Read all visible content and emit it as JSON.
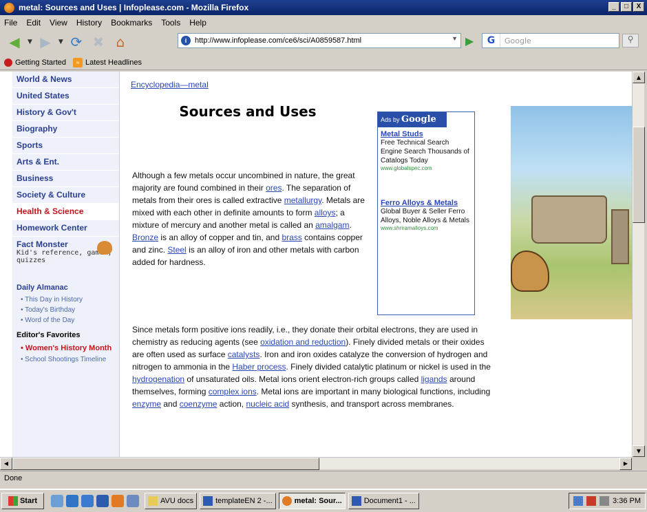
{
  "window": {
    "title": "metal: Sources and Uses | Infoplease.com - Mozilla Firefox",
    "controls": [
      "_",
      "□",
      "X"
    ]
  },
  "menu": [
    "File",
    "Edit",
    "View",
    "History",
    "Bookmarks",
    "Tools",
    "Help"
  ],
  "toolbar": {
    "url": "http://www.infoplease.com/ce6/sci/A0859587.html",
    "search_placeholder": "Google",
    "search_engine": "G"
  },
  "bookmarks": [
    "Getting Started",
    "Latest Headlines"
  ],
  "sidebar": {
    "items": [
      {
        "label": "World & News",
        "active": false
      },
      {
        "label": "United States",
        "active": false
      },
      {
        "label": "History & Gov't",
        "active": false
      },
      {
        "label": "Biography",
        "active": false
      },
      {
        "label": "Sports",
        "active": false
      },
      {
        "label": "Arts & Ent.",
        "active": false
      },
      {
        "label": "Business",
        "active": false
      },
      {
        "label": "Society & Culture",
        "active": false
      },
      {
        "label": "Health & Science",
        "active": true
      },
      {
        "label": "Homework Center",
        "active": false
      }
    ],
    "fact_monster": {
      "title": "Fact Monster",
      "desc": "Kid's reference, games, quizzes"
    },
    "almanac": {
      "title": "Daily Almanac",
      "links": [
        "This Day in History",
        "Today's Birthday",
        "Word of the Day"
      ]
    },
    "favorites": {
      "title": "Editor's Favorites",
      "links": [
        "Women's History Month",
        "School Shootings Timeline"
      ]
    }
  },
  "article": {
    "breadcrumb": [
      "Encyclopedia",
      "metal"
    ],
    "title": "Sources and Uses",
    "p1": "Although a few metals occur uncombined in nature, the great majority are found combined in their ores. The separation of metals from their ores is called extractive metallurgy. Metals are mixed with each other in definite amounts to form alloys; a mixture of mercury and another metal is called an amalgam. Bronze is an alloy of copper and tin, and brass contains copper and zinc. Steel is an alloy of iron and other metals with carbon added for hardness.",
    "p2": "Since metals form positive ions readily, i.e., they donate their orbital electrons, they are used in chemistry as reducing agents (see oxidation and reduction). Finely divided metals or their oxides are often used as surface catalysts. Iron and iron oxides catalyze the conversion of hydrogen and nitrogen to ammonia in the Haber process. Finely divided catalytic platinum or nickel is used in the hydrogenation of unsaturated oils. Metal ions orient electron-rich groups called ligands around themselves, forming complex ions. Metal ions are important in many biological functions, including enzyme and coenzyme action, nucleic acid synthesis, and transport across membranes."
  },
  "ads": {
    "header_small": "Ads by",
    "header_brand": "Google",
    "items": [
      {
        "title": "Metal Studs",
        "desc": "Free Technical Search Engine Search Thousands of Catalogs Today",
        "url": "www.globalspec.com"
      },
      {
        "title": "Ferro Alloys & Metals",
        "desc": "Global Buyer & Seller Ferro Alloys, Noble Alloys & Metals",
        "url": "www.shriramalloys.com"
      }
    ]
  },
  "status": "Done",
  "taskbar": {
    "start": "Start",
    "items": [
      {
        "label": "AVU docs",
        "active": false
      },
      {
        "label": "templateEN 2 -...",
        "active": false
      },
      {
        "label": "metal: Sour...",
        "active": true
      },
      {
        "label": "Document1 - ...",
        "active": false
      }
    ],
    "clock": "3:36 PM"
  }
}
